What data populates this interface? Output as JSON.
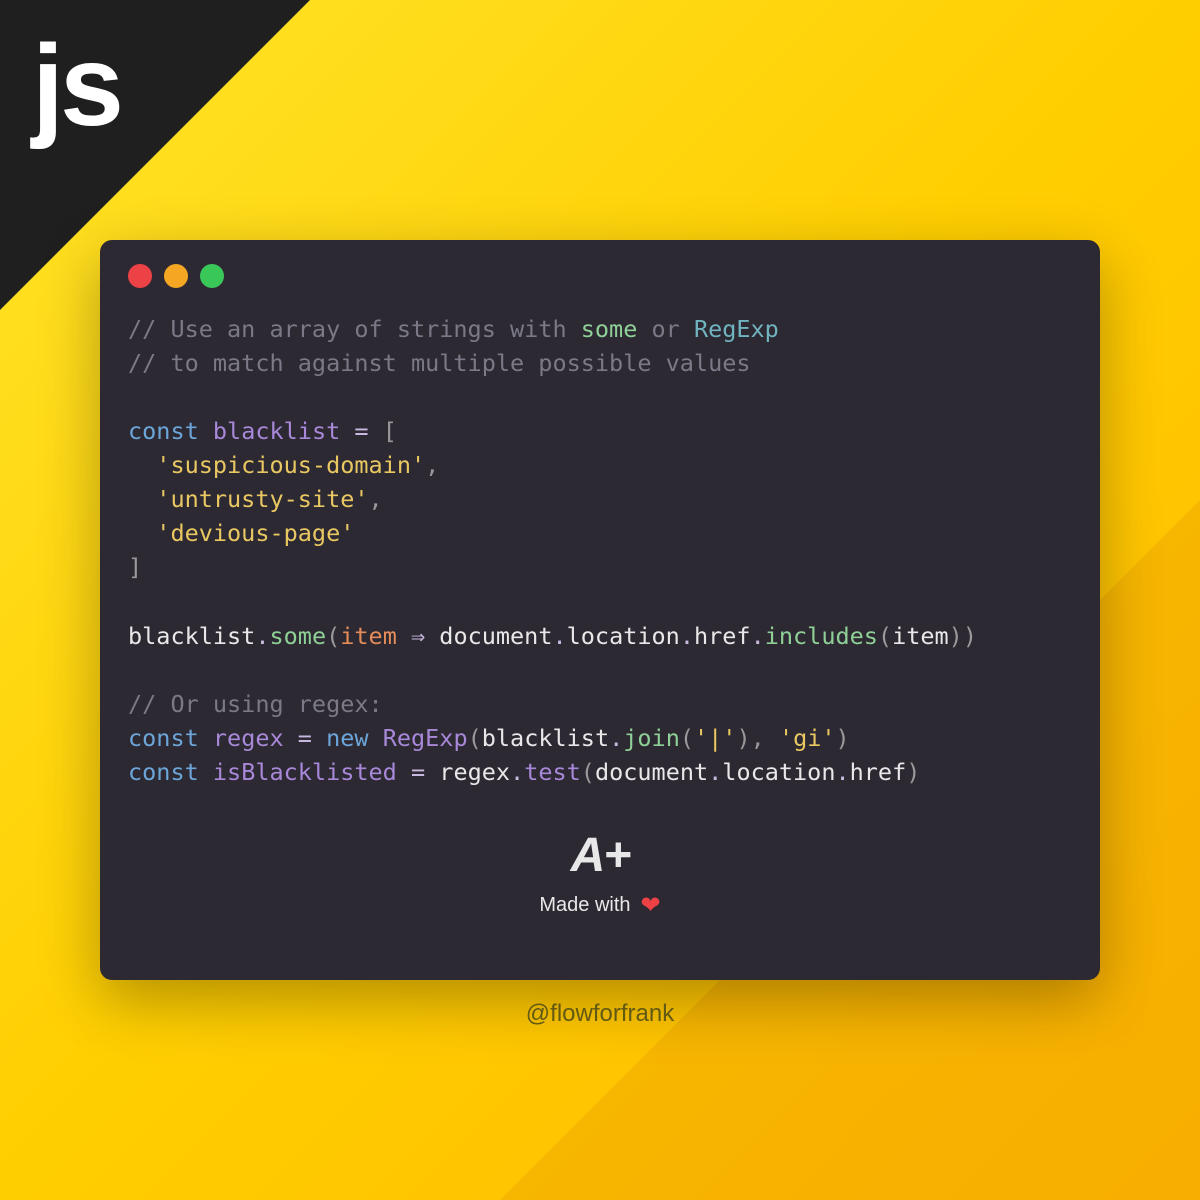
{
  "logo": "js",
  "window": {
    "dots": [
      "red",
      "yellow",
      "green"
    ]
  },
  "code": {
    "comment1": "// Use an array of strings with ",
    "comment1_some": "some",
    "comment1_or": " or ",
    "comment1_regexp": "RegExp",
    "comment2": "// to match against multiple possible values",
    "const": "const",
    "blacklist_var": "blacklist",
    "eq": " = ",
    "open_bracket": "[",
    "str1": "'suspicious-domain'",
    "str2": "'untrusty-site'",
    "str3": "'devious-page'",
    "close_bracket": "]",
    "comma": ",",
    "blacklist_ref": "blacklist",
    "dot": ".",
    "some": "some",
    "lparen": "(",
    "rparen": ")",
    "item": "item",
    "arrow": " ⇒ ",
    "document": "document",
    "location": "location",
    "href": "href",
    "includes": "includes",
    "comment3": "// Or using regex:",
    "regex_var": "regex",
    "new": "new",
    "RegExp": "RegExp",
    "join": "join",
    "pipe_str": "'|'",
    "gi_str": "'gi'",
    "isBlacklisted": "isBlacklisted",
    "test": "test"
  },
  "footer": {
    "logo": "A+",
    "made_with": "Made with",
    "heart": "❤"
  },
  "handle": "@flowforfrank"
}
